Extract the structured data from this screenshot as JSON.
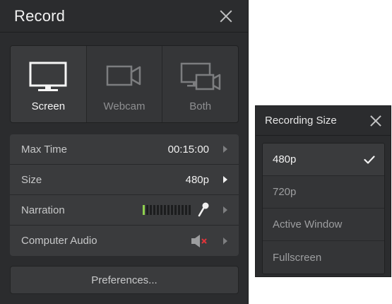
{
  "record": {
    "title": "Record",
    "modes": [
      {
        "label": "Screen",
        "icon": "monitor-icon",
        "active": true
      },
      {
        "label": "Webcam",
        "icon": "webcam-icon",
        "active": false
      },
      {
        "label": "Both",
        "icon": "screen-and-webcam-icon",
        "active": false
      }
    ],
    "settings": [
      {
        "label": "Max Time",
        "value": "00:15:00"
      },
      {
        "label": "Size",
        "value": "480p"
      },
      {
        "label": "Narration",
        "icon": "microphone-icon",
        "meter_level": 0.07
      },
      {
        "label": "Computer Audio",
        "icon": "speaker-muted-icon",
        "muted": true
      }
    ],
    "preferences_label": "Preferences..."
  },
  "recording_size": {
    "title": "Recording Size",
    "options": [
      "480p",
      "720p",
      "Active Window",
      "Fullscreen"
    ],
    "selected": "480p"
  },
  "colors": {
    "panel_bg": "#2b2c2e",
    "row_bg": "#3a3b3d",
    "meter_on": "#8fd14f",
    "muted_x": "#e0343a"
  }
}
